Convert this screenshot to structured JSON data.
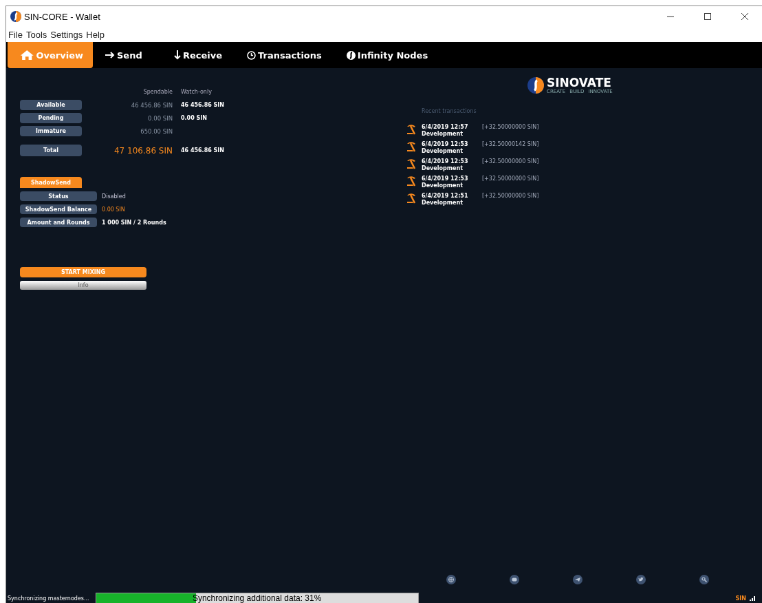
{
  "window": {
    "title": "SIN-CORE - Wallet"
  },
  "menu": [
    "File",
    "Tools",
    "Settings",
    "Help"
  ],
  "tabs": [
    {
      "label": "Overview",
      "selected": true
    },
    {
      "label": "Send",
      "selected": false
    },
    {
      "label": "Receive",
      "selected": false
    },
    {
      "label": "Transactions",
      "selected": false
    },
    {
      "label": "Infinity Nodes",
      "selected": false
    }
  ],
  "balances": {
    "headers": [
      "Spendable",
      "Watch-only"
    ],
    "rows": [
      {
        "label": "Available",
        "spendable": "46 456.86 SIN",
        "watch_only": "46 456.86 SIN"
      },
      {
        "label": "Pending",
        "spendable": "0.00 SIN",
        "watch_only": "0.00 SIN"
      },
      {
        "label": "Immature",
        "spendable": "650.00 SIN"
      },
      {
        "label": "Total",
        "spendable": "47 106.86 SIN",
        "watch_only": "46 456.86 SIN",
        "kind": "total"
      }
    ]
  },
  "shadowsend": {
    "title": "ShadowSend",
    "rows": [
      {
        "label": "Status",
        "value": "Disabled"
      },
      {
        "label": "ShadowSend Balance",
        "value": "0.00 SIN",
        "kind": "highlight"
      },
      {
        "label": "Amount and Rounds",
        "value": "1 000 SIN / 2 Rounds",
        "kind": "bold"
      }
    ],
    "buttons": [
      "START MIXING",
      "Info"
    ]
  },
  "logo": {
    "name": "SINOVATE",
    "tagline": [
      "CREATE",
      "BUILD",
      "INNOVATE"
    ]
  },
  "recent_transactions": {
    "title": "Recent transactions",
    "items": [
      {
        "date": "6/4/2019 12:57",
        "label": "Development",
        "amount": "[+32.50000000 SIN]"
      },
      {
        "date": "6/4/2019 12:53",
        "label": "Development",
        "amount": "[+32.50000142 SIN]"
      },
      {
        "date": "6/4/2019 12:53",
        "label": "Development",
        "amount": "[+32.50000000 SIN]"
      },
      {
        "date": "6/4/2019 12:53",
        "label": "Development",
        "amount": "[+32.50000000 SIN]"
      },
      {
        "date": "6/4/2019 12:51",
        "label": "Development",
        "amount": "[+32.50000000 SIN]"
      }
    ]
  },
  "status_bar": {
    "message": "Synchronizing masternodes...",
    "progress": {
      "label": "Synchronizing additional data: 31%",
      "level": 0.31
    },
    "unit": "SIN"
  }
}
